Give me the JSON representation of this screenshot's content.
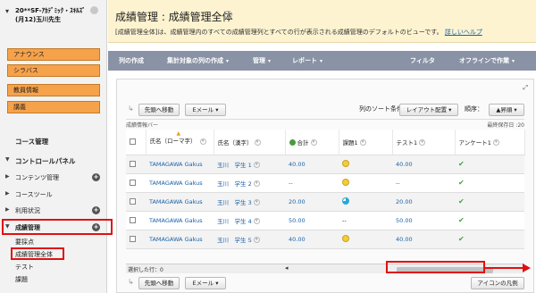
{
  "sidebar": {
    "course_title": "20**SF-ｱｶﾃﾞﾐｯｸ・ｽｷﾙｽﾞ",
    "course_subtitle": "(月12)玉川先生",
    "menu_buttons": [
      "アナウンス",
      "シラバス",
      "教員情報",
      "講義"
    ],
    "course_management": "コース管理",
    "control_panel": "コントロールパネル",
    "nav_items": [
      "コンテンツ管理",
      "コースツール",
      "利用状況",
      "成績管理"
    ],
    "sub_items": [
      "要採点",
      "成績管理全体",
      "テスト",
      "課題"
    ]
  },
  "header": {
    "title": "成績管理 : 成績管理全体",
    "description": "[成績管理全体]は、成績管理内のすべての成績管理列とすべての行が表示される成績管理のデフォルトのビューです。",
    "help_link": "詳しいヘルプ"
  },
  "action_bar": {
    "create_column": "列の作成",
    "create_calc_column": "集計対象の列の作成",
    "manage": "管理",
    "reports": "レポート",
    "filter": "フィルタ",
    "offline": "オフラインで作業"
  },
  "grid_toolbar": {
    "move_top": "先頭へ移動",
    "email": "Eメール",
    "sort_label": "列のソート条件：",
    "layout_option": "レイアウト配置",
    "order_label": "順序：",
    "order_option": "▲昇順",
    "info_bar": "成績情報バー",
    "last_saved": "最終保存日 :20"
  },
  "table": {
    "headers": [
      "氏名（ローマ字）",
      "氏名（漢字）",
      "合計",
      "課題1",
      "テスト1",
      "アンケート1"
    ],
    "rows": [
      {
        "romaji": "TAMAGAWA Gakus",
        "kanji": "玉川　学生 1",
        "total": "40.00",
        "kadai": "smile",
        "test": "40.00",
        "survey": "✔"
      },
      {
        "romaji": "TAMAGAWA Gakus",
        "kanji": "玉川　学生 2",
        "total": "--",
        "kadai": "smile",
        "test": "--",
        "survey": "✔"
      },
      {
        "romaji": "TAMAGAWA Gakus",
        "kanji": "玉川　学生 3",
        "total": "20.00",
        "kadai": "pie",
        "test": "20.00",
        "survey": "✔"
      },
      {
        "romaji": "TAMAGAWA Gakus",
        "kanji": "玉川　学生 4",
        "total": "50.00",
        "kadai": "--",
        "test": "50.00",
        "survey": "✔"
      },
      {
        "romaji": "TAMAGAWA Gakus",
        "kanji": "玉川　学生 5",
        "total": "40.00",
        "kadai": "smile",
        "test": "40.00",
        "survey": "✔"
      }
    ]
  },
  "footer": {
    "selected_rows": "選択した行：0",
    "icon_legend": "アイコンの凡例"
  },
  "colors": {
    "menu_button": "#f6a24a",
    "title_bar": "#fdf3d0",
    "action_bar": "#8a93a5",
    "highlight": "#e01010",
    "link": "#1b62a8"
  }
}
